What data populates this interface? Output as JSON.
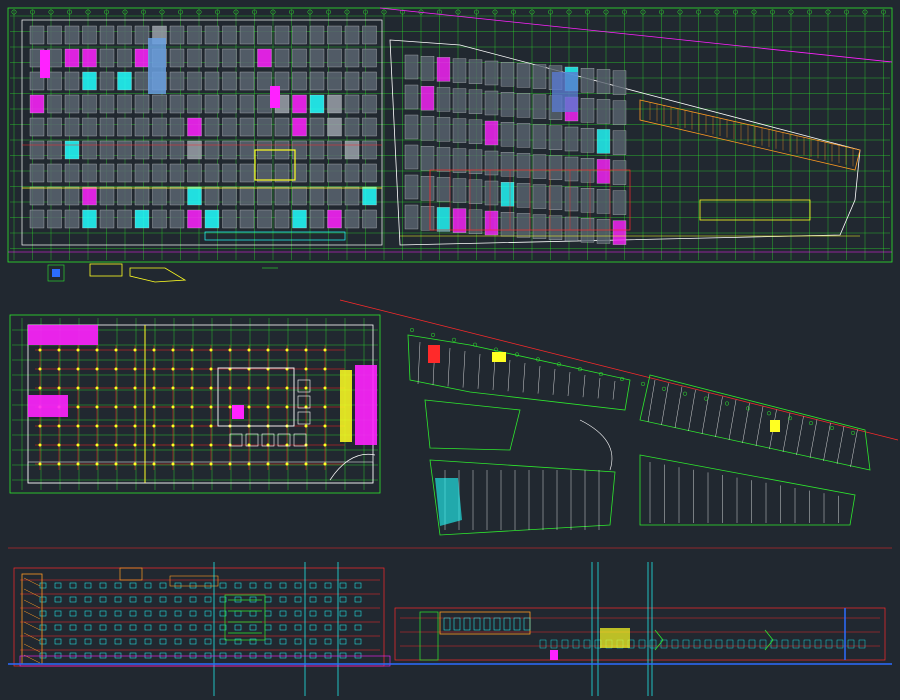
{
  "canvas": {
    "background": "#212830",
    "colors": {
      "grid": "#2ee82e",
      "wall": "#ffffff",
      "room_fill": "#5a6470",
      "column": "#ff2222",
      "magenta": "#ff22ff",
      "yellow": "#ffff22",
      "cyan": "#22ffff",
      "blue": "#2c6cff",
      "red": "#ff2a2a",
      "orange": "#ff9a22"
    }
  },
  "sheets": [
    {
      "kind": "floor-plan-upper",
      "panel": "drawing-top"
    },
    {
      "kind": "floor-plan-middle",
      "panel": "drawing-middle"
    },
    {
      "kind": "section-elevation",
      "panel": "drawing-bottom"
    }
  ],
  "labels": {
    "top_left_caption": "",
    "middle_caption": "",
    "bottom_left_caption": "",
    "bottom_mid_caption": "",
    "bottom_right_caption": ""
  }
}
